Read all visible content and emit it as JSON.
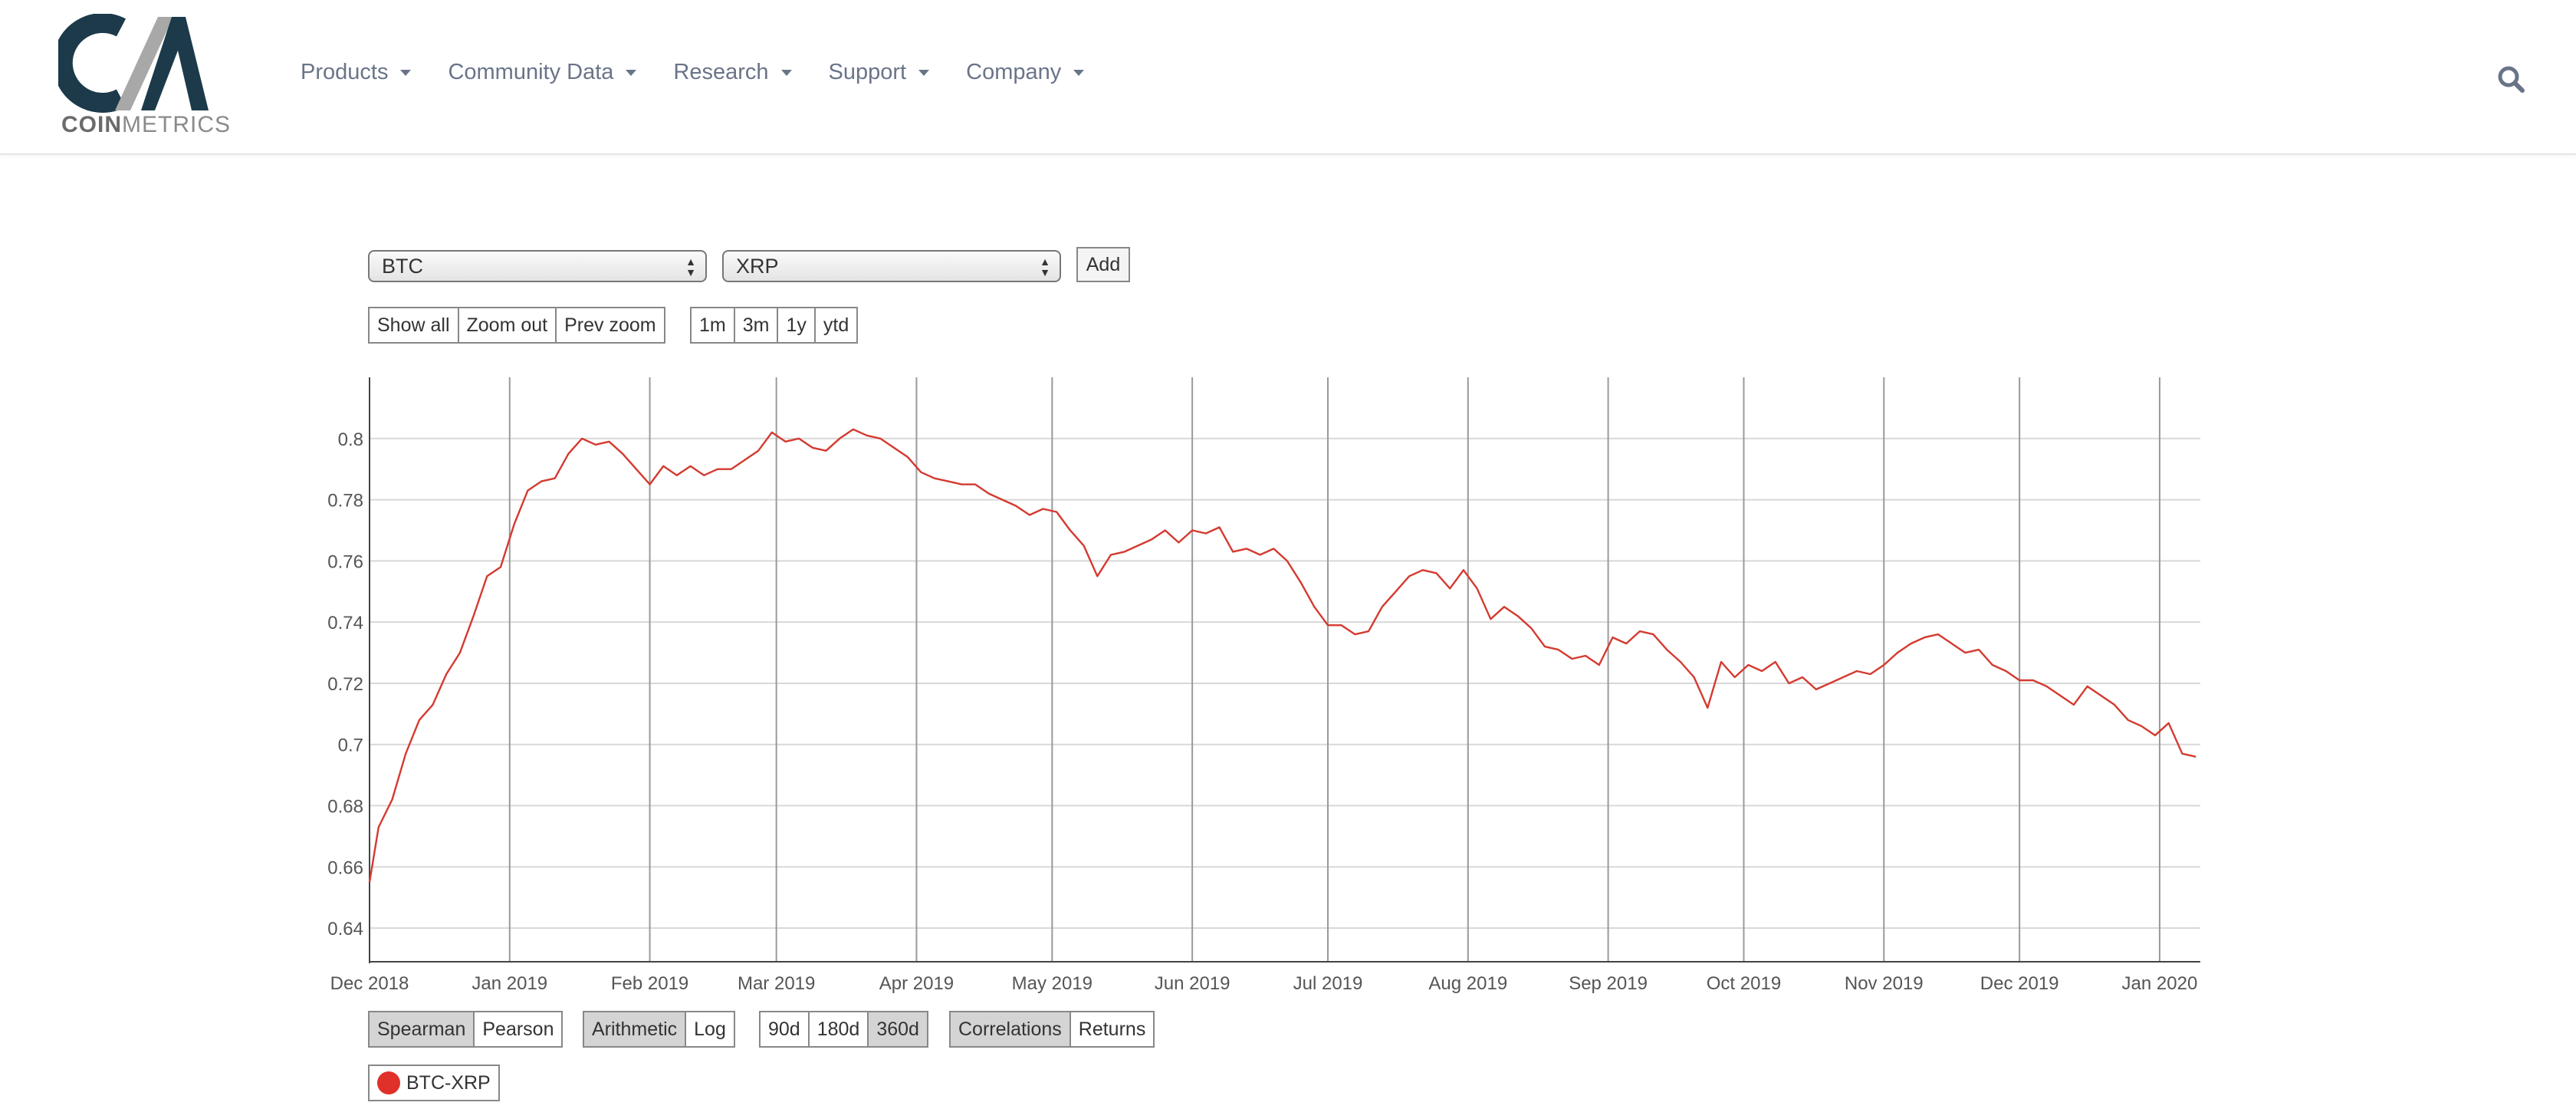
{
  "brand": {
    "logo_text_bold": "COIN",
    "logo_text_light": "METRICS",
    "logo_color_dark": "#1c3a4a",
    "logo_color_grey": "#a8a8a8"
  },
  "nav": {
    "items": [
      {
        "label": "Products"
      },
      {
        "label": "Community Data"
      },
      {
        "label": "Research"
      },
      {
        "label": "Support"
      },
      {
        "label": "Company"
      }
    ],
    "search_icon": "search-icon"
  },
  "controls": {
    "asset1": "BTC",
    "asset2": "XRP",
    "add_label": "Add",
    "zoom_buttons": [
      "Show all",
      "Zoom out",
      "Prev zoom"
    ],
    "range_buttons": [
      "1m",
      "3m",
      "1y",
      "ytd"
    ]
  },
  "options": {
    "method": [
      {
        "label": "Spearman",
        "active": true
      },
      {
        "label": "Pearson",
        "active": false
      }
    ],
    "scale": [
      {
        "label": "Arithmetic",
        "active": true
      },
      {
        "label": "Log",
        "active": false
      }
    ],
    "window": [
      {
        "label": "90d",
        "active": false
      },
      {
        "label": "180d",
        "active": false
      },
      {
        "label": "360d",
        "active": true
      }
    ],
    "mode": [
      {
        "label": "Correlations",
        "active": true
      },
      {
        "label": "Returns",
        "active": false
      }
    ]
  },
  "legend": {
    "label": "BTC-XRP",
    "color": "#e0302a"
  },
  "chart_data": {
    "type": "line",
    "series": [
      {
        "name": "BTC-XRP",
        "color": "#d43a30",
        "points": [
          [
            "2018-12-01",
            0.655
          ],
          [
            "2018-12-03",
            0.673
          ],
          [
            "2018-12-06",
            0.682
          ],
          [
            "2018-12-09",
            0.697
          ],
          [
            "2018-12-12",
            0.708
          ],
          [
            "2018-12-15",
            0.713
          ],
          [
            "2018-12-18",
            0.723
          ],
          [
            "2018-12-21",
            0.73
          ],
          [
            "2018-12-24",
            0.742
          ],
          [
            "2018-12-27",
            0.755
          ],
          [
            "2018-12-30",
            0.758
          ],
          [
            "2019-01-02",
            0.772
          ],
          [
            "2019-01-05",
            0.783
          ],
          [
            "2019-01-08",
            0.786
          ],
          [
            "2019-01-11",
            0.787
          ],
          [
            "2019-01-14",
            0.795
          ],
          [
            "2019-01-17",
            0.8
          ],
          [
            "2019-01-20",
            0.798
          ],
          [
            "2019-01-23",
            0.799
          ],
          [
            "2019-01-26",
            0.795
          ],
          [
            "2019-01-29",
            0.79
          ],
          [
            "2019-02-01",
            0.785
          ],
          [
            "2019-02-04",
            0.791
          ],
          [
            "2019-02-07",
            0.788
          ],
          [
            "2019-02-10",
            0.791
          ],
          [
            "2019-02-13",
            0.788
          ],
          [
            "2019-02-16",
            0.79
          ],
          [
            "2019-02-19",
            0.79
          ],
          [
            "2019-02-22",
            0.793
          ],
          [
            "2019-02-25",
            0.796
          ],
          [
            "2019-02-28",
            0.802
          ],
          [
            "2019-03-03",
            0.799
          ],
          [
            "2019-03-06",
            0.8
          ],
          [
            "2019-03-09",
            0.797
          ],
          [
            "2019-03-12",
            0.796
          ],
          [
            "2019-03-15",
            0.8
          ],
          [
            "2019-03-18",
            0.803
          ],
          [
            "2019-03-21",
            0.801
          ],
          [
            "2019-03-24",
            0.8
          ],
          [
            "2019-03-27",
            0.797
          ],
          [
            "2019-03-30",
            0.794
          ],
          [
            "2019-04-02",
            0.789
          ],
          [
            "2019-04-05",
            0.787
          ],
          [
            "2019-04-08",
            0.786
          ],
          [
            "2019-04-11",
            0.785
          ],
          [
            "2019-04-14",
            0.785
          ],
          [
            "2019-04-17",
            0.782
          ],
          [
            "2019-04-20",
            0.78
          ],
          [
            "2019-04-23",
            0.778
          ],
          [
            "2019-04-26",
            0.775
          ],
          [
            "2019-04-29",
            0.777
          ],
          [
            "2019-05-02",
            0.776
          ],
          [
            "2019-05-05",
            0.77
          ],
          [
            "2019-05-08",
            0.765
          ],
          [
            "2019-05-11",
            0.755
          ],
          [
            "2019-05-14",
            0.762
          ],
          [
            "2019-05-17",
            0.763
          ],
          [
            "2019-05-20",
            0.765
          ],
          [
            "2019-05-23",
            0.767
          ],
          [
            "2019-05-26",
            0.77
          ],
          [
            "2019-05-29",
            0.766
          ],
          [
            "2019-06-01",
            0.77
          ],
          [
            "2019-06-04",
            0.769
          ],
          [
            "2019-06-07",
            0.771
          ],
          [
            "2019-06-10",
            0.763
          ],
          [
            "2019-06-13",
            0.764
          ],
          [
            "2019-06-16",
            0.762
          ],
          [
            "2019-06-19",
            0.764
          ],
          [
            "2019-06-22",
            0.76
          ],
          [
            "2019-06-25",
            0.753
          ],
          [
            "2019-06-28",
            0.745
          ],
          [
            "2019-07-01",
            0.739
          ],
          [
            "2019-07-04",
            0.739
          ],
          [
            "2019-07-07",
            0.736
          ],
          [
            "2019-07-10",
            0.737
          ],
          [
            "2019-07-13",
            0.745
          ],
          [
            "2019-07-16",
            0.75
          ],
          [
            "2019-07-19",
            0.755
          ],
          [
            "2019-07-22",
            0.757
          ],
          [
            "2019-07-25",
            0.756
          ],
          [
            "2019-07-28",
            0.751
          ],
          [
            "2019-07-31",
            0.757
          ],
          [
            "2019-08-03",
            0.751
          ],
          [
            "2019-08-06",
            0.741
          ],
          [
            "2019-08-09",
            0.745
          ],
          [
            "2019-08-12",
            0.742
          ],
          [
            "2019-08-15",
            0.738
          ],
          [
            "2019-08-18",
            0.732
          ],
          [
            "2019-08-21",
            0.731
          ],
          [
            "2019-08-24",
            0.728
          ],
          [
            "2019-08-27",
            0.729
          ],
          [
            "2019-08-30",
            0.726
          ],
          [
            "2019-09-02",
            0.735
          ],
          [
            "2019-09-05",
            0.733
          ],
          [
            "2019-09-08",
            0.737
          ],
          [
            "2019-09-11",
            0.736
          ],
          [
            "2019-09-14",
            0.731
          ],
          [
            "2019-09-17",
            0.727
          ],
          [
            "2019-09-20",
            0.722
          ],
          [
            "2019-09-23",
            0.712
          ],
          [
            "2019-09-26",
            0.727
          ],
          [
            "2019-09-29",
            0.722
          ],
          [
            "2019-10-02",
            0.726
          ],
          [
            "2019-10-05",
            0.724
          ],
          [
            "2019-10-08",
            0.727
          ],
          [
            "2019-10-11",
            0.72
          ],
          [
            "2019-10-14",
            0.722
          ],
          [
            "2019-10-17",
            0.718
          ],
          [
            "2019-10-20",
            0.72
          ],
          [
            "2019-10-23",
            0.722
          ],
          [
            "2019-10-26",
            0.724
          ],
          [
            "2019-10-29",
            0.723
          ],
          [
            "2019-11-01",
            0.726
          ],
          [
            "2019-11-04",
            0.73
          ],
          [
            "2019-11-07",
            0.733
          ],
          [
            "2019-11-10",
            0.735
          ],
          [
            "2019-11-13",
            0.736
          ],
          [
            "2019-11-16",
            0.733
          ],
          [
            "2019-11-19",
            0.73
          ],
          [
            "2019-11-22",
            0.731
          ],
          [
            "2019-11-25",
            0.726
          ],
          [
            "2019-11-28",
            0.724
          ],
          [
            "2019-12-01",
            0.721
          ],
          [
            "2019-12-04",
            0.721
          ],
          [
            "2019-12-07",
            0.719
          ],
          [
            "2019-12-10",
            0.716
          ],
          [
            "2019-12-13",
            0.713
          ],
          [
            "2019-12-16",
            0.719
          ],
          [
            "2019-12-19",
            0.716
          ],
          [
            "2019-12-22",
            0.713
          ],
          [
            "2019-12-25",
            0.708
          ],
          [
            "2019-12-28",
            0.706
          ],
          [
            "2019-12-31",
            0.703
          ],
          [
            "2020-01-03",
            0.707
          ],
          [
            "2020-01-06",
            0.697
          ],
          [
            "2020-01-09",
            0.696
          ]
        ]
      }
    ],
    "x_ticks": [
      "Dec 2018",
      "Jan 2019",
      "Feb 2019",
      "Mar 2019",
      "Apr 2019",
      "May 2019",
      "Jun 2019",
      "Jul 2019",
      "Aug 2019",
      "Sep 2019",
      "Oct 2019",
      "Nov 2019",
      "Dec 2019",
      "Jan 2020"
    ],
    "x_tick_dates": [
      "2018-12-01",
      "2019-01-01",
      "2019-02-01",
      "2019-03-01",
      "2019-04-01",
      "2019-05-01",
      "2019-06-01",
      "2019-07-01",
      "2019-08-01",
      "2019-09-01",
      "2019-10-01",
      "2019-11-01",
      "2019-12-01",
      "2020-01-01"
    ],
    "xlim": [
      "2018-12-01",
      "2020-01-10"
    ],
    "y_ticks": [
      0.64,
      0.66,
      0.68,
      0.7,
      0.72,
      0.74,
      0.76,
      0.78,
      0.8
    ],
    "ylim": [
      0.629,
      0.82
    ],
    "grid": true
  }
}
